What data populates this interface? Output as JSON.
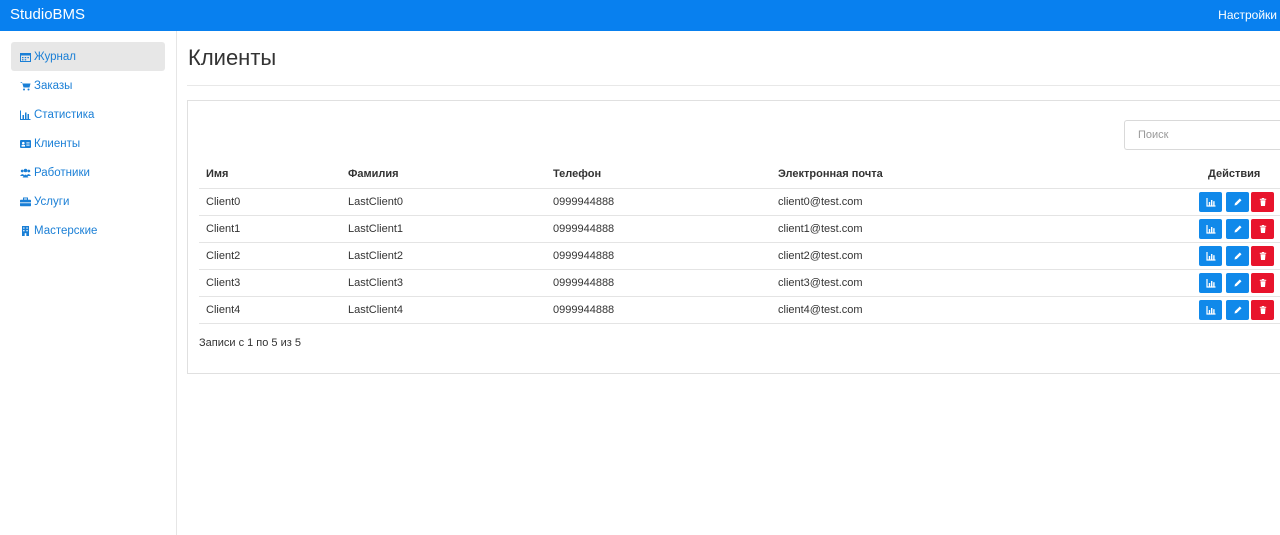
{
  "navbar": {
    "brand": "StudioBMS",
    "settings_label": "Настройки"
  },
  "sidebar": {
    "items": [
      {
        "label": "Журнал",
        "icon": "calendar-icon",
        "active": true
      },
      {
        "label": "Заказы",
        "icon": "cart-icon",
        "active": false
      },
      {
        "label": "Статистика",
        "icon": "bar-chart-icon",
        "active": false
      },
      {
        "label": "Клиенты",
        "icon": "contact-card-icon",
        "active": false
      },
      {
        "label": "Работники",
        "icon": "users-icon",
        "active": false
      },
      {
        "label": "Услуги",
        "icon": "briefcase-icon",
        "active": false
      },
      {
        "label": "Мастерские",
        "icon": "building-icon",
        "active": false
      }
    ]
  },
  "page": {
    "title": "Клиенты"
  },
  "search": {
    "placeholder": "Поиск",
    "value": ""
  },
  "table": {
    "columns": [
      "Имя",
      "Фамилия",
      "Телефон",
      "Электронная почта",
      "Действия"
    ],
    "rows": [
      {
        "first": "Client0",
        "last": "LastClient0",
        "phone": "0999944888",
        "email": "client0@test.com"
      },
      {
        "first": "Client1",
        "last": "LastClient1",
        "phone": "0999944888",
        "email": "client1@test.com"
      },
      {
        "first": "Client2",
        "last": "LastClient2",
        "phone": "0999944888",
        "email": "client2@test.com"
      },
      {
        "first": "Client3",
        "last": "LastClient3",
        "phone": "0999944888",
        "email": "client3@test.com"
      },
      {
        "first": "Client4",
        "last": "LastClient4",
        "phone": "0999944888",
        "email": "client4@test.com"
      }
    ],
    "row_actions": [
      {
        "icon": "bar-chart-icon",
        "color": "#1089ea"
      },
      {
        "icon": "pencil-icon",
        "color": "#1089ea"
      },
      {
        "icon": "trash-icon",
        "color": "#e8142c"
      }
    ]
  },
  "footer": {
    "info": "Записи с 1 по 5 из 5"
  },
  "colors": {
    "primary": "#0880ef",
    "link": "#1a7fd6",
    "danger": "#e8142c"
  }
}
